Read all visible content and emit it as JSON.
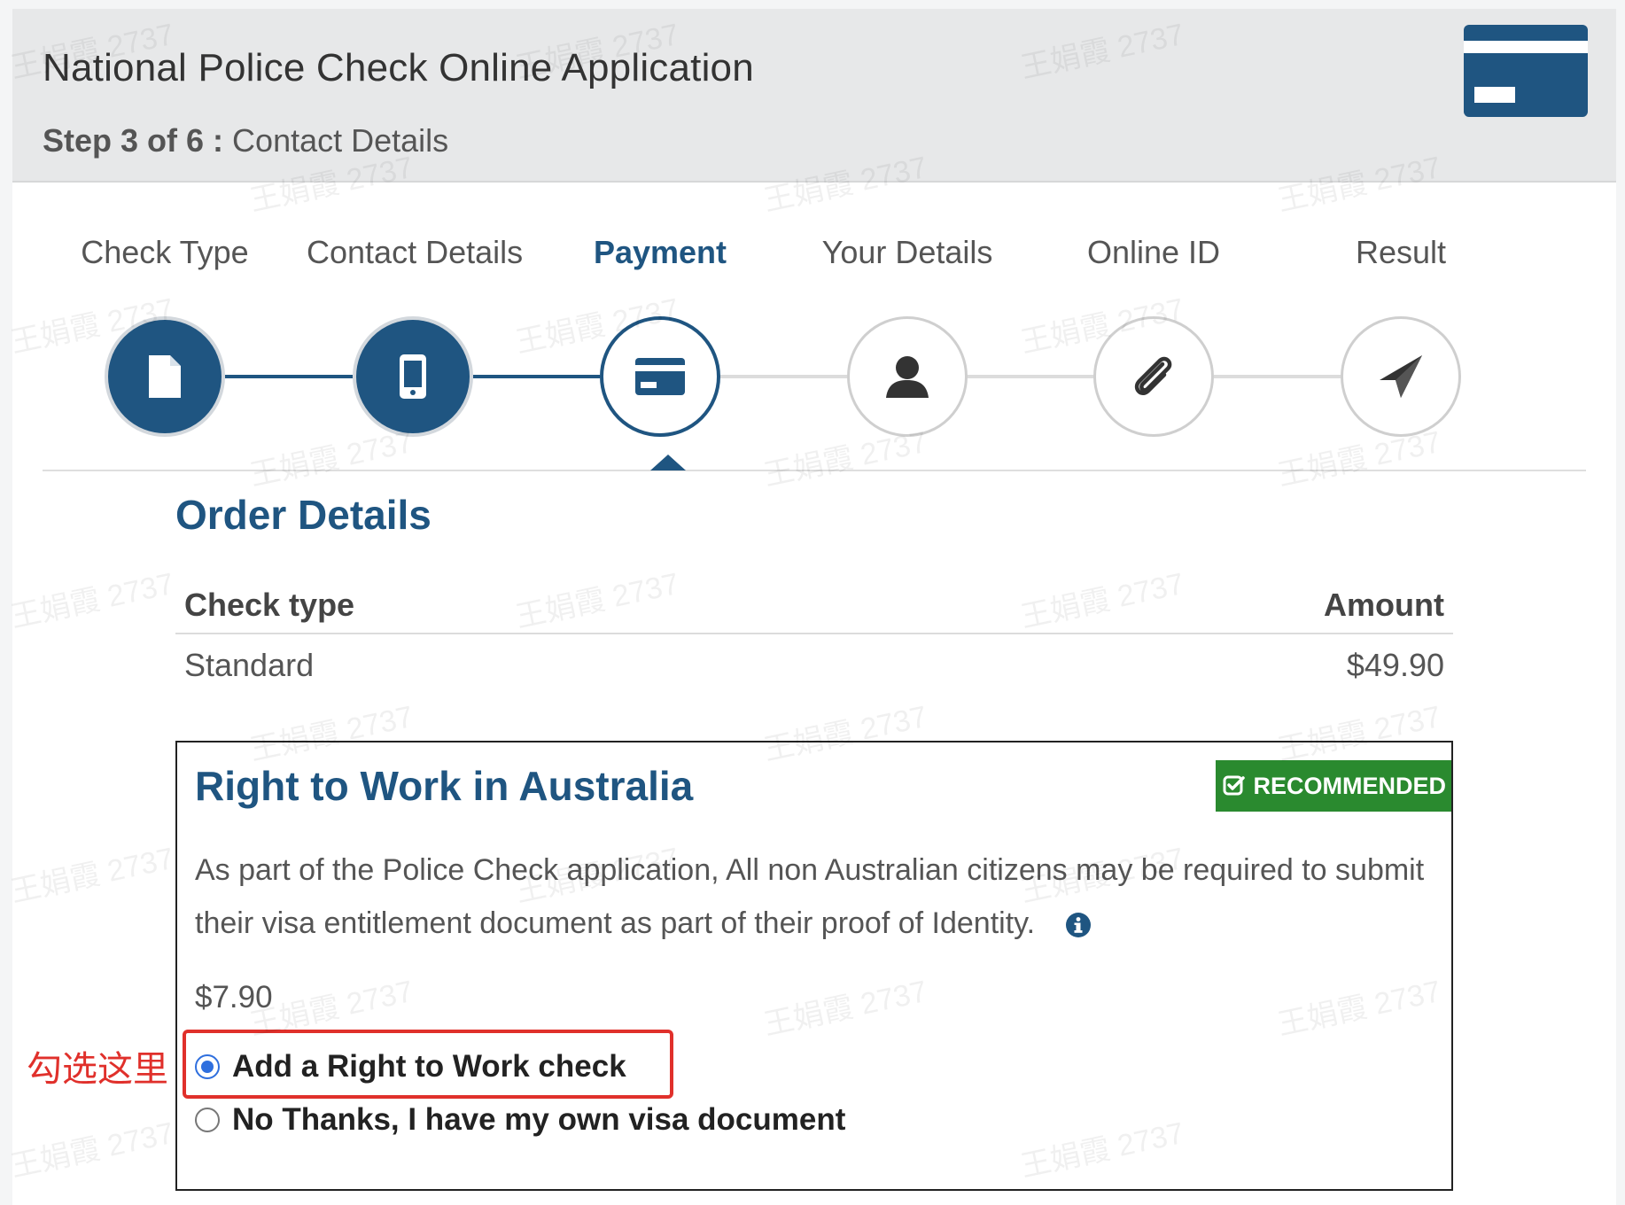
{
  "header": {
    "title": "National Police Check Online Application",
    "step_prefix": "Step 3 of 6 :",
    "step_name": "Contact Details",
    "card_icon": "credit-card-icon"
  },
  "progress": {
    "steps": [
      {
        "label": "Check Type",
        "icon": "document-icon",
        "state": "done"
      },
      {
        "label": "Contact Details",
        "icon": "mobile-phone-icon",
        "state": "done"
      },
      {
        "label": "Payment",
        "icon": "credit-card-icon",
        "state": "active"
      },
      {
        "label": "Your Details",
        "icon": "user-icon",
        "state": "todo"
      },
      {
        "label": "Online ID",
        "icon": "paperclip-icon",
        "state": "todo"
      },
      {
        "label": "Result",
        "icon": "paper-plane-icon",
        "state": "todo"
      }
    ]
  },
  "order": {
    "title": "Order Details",
    "columns": [
      "Check type",
      "Amount"
    ],
    "rows": [
      {
        "type": "Standard",
        "amount": "$49.90"
      }
    ]
  },
  "right_to_work": {
    "title": "Right to Work in Australia",
    "badge": "RECOMMENDED",
    "description": "As part of the Police Check application, All non Australian citizens may be required to submit their visa entitlement document as part of their proof of Identity.",
    "price": "$7.90",
    "options": [
      {
        "label": "Add a Right to Work check",
        "selected": true
      },
      {
        "label": "No Thanks, I have my own visa document",
        "selected": false
      }
    ]
  },
  "annotation": {
    "label": "勾选这里"
  },
  "watermark": "王娟霞 2737",
  "colors": {
    "primary": "#1f5581",
    "badge_green": "#2a8a2f",
    "annotation_red": "#e0302b",
    "radio_blue": "#2f6fde"
  }
}
